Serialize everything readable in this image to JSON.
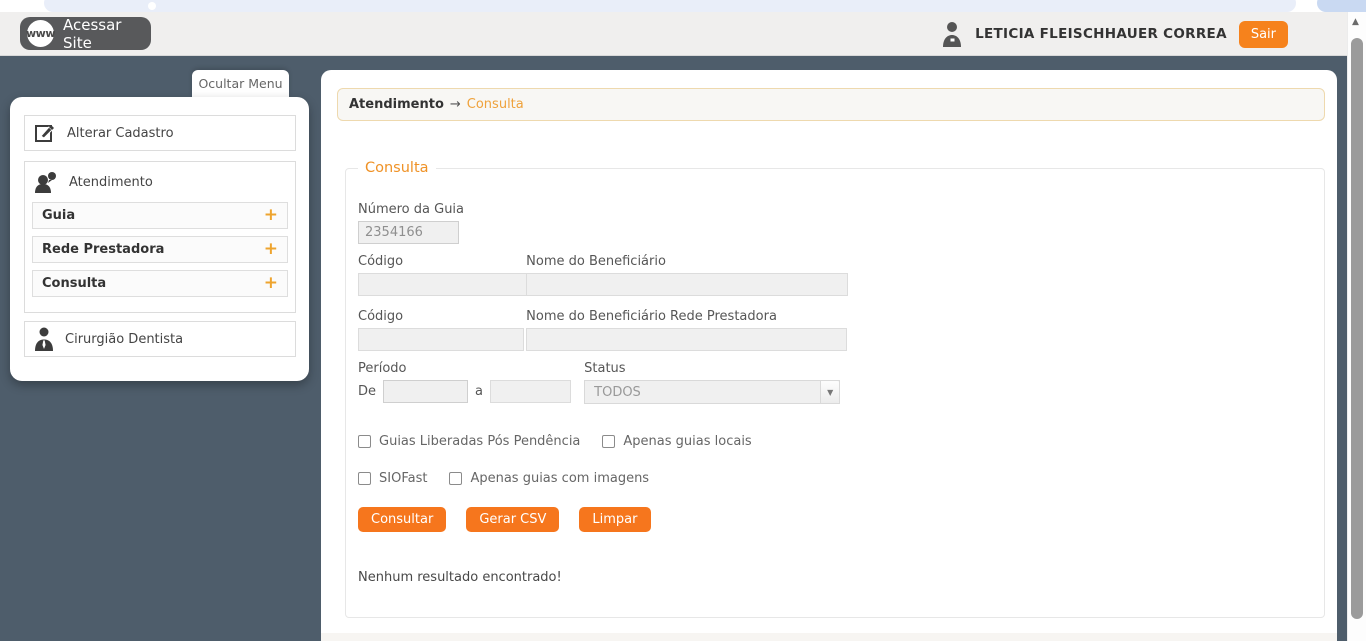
{
  "header": {
    "www_icon_text": "www",
    "access_site_label": "Acessar Site",
    "user_name": "LETICIA FLEISCHHAUER CORREA",
    "logout_label": "Sair"
  },
  "sidebar": {
    "hide_menu_label": "Ocultar Menu",
    "items": [
      {
        "label": "Alterar Cadastro",
        "icon": "edit-icon"
      },
      {
        "label": "Atendimento",
        "icon": "people-icon"
      }
    ],
    "accordion": [
      {
        "label": "Guia",
        "expander": "+"
      },
      {
        "label": "Rede Prestadora",
        "expander": "+"
      },
      {
        "label": "Consulta",
        "expander": "+"
      }
    ],
    "footer_item": {
      "label": "Cirurgião Dentista",
      "icon": "dentist-icon"
    }
  },
  "breadcrumb": {
    "section": "Atendimento",
    "arrow": "→",
    "current": "Consulta"
  },
  "form": {
    "legend": "Consulta",
    "numero_guia": {
      "label": "Número da Guia",
      "value": "2354166"
    },
    "codigo1": {
      "label": "Código",
      "value": ""
    },
    "nome_beneficiario": {
      "label": "Nome do Beneficiário",
      "value": ""
    },
    "codigo2": {
      "label": "Código",
      "value": ""
    },
    "nome_rede": {
      "label": "Nome do Beneficiário Rede Prestadora",
      "value": ""
    },
    "periodo": {
      "label": "Período",
      "de": "De",
      "de_value": "",
      "a": "a",
      "a_value": ""
    },
    "status": {
      "label": "Status",
      "value": "TODOS"
    },
    "checkboxes": [
      {
        "label": "Guias Liberadas Pós Pendência",
        "checked": false
      },
      {
        "label": "Apenas guias locais",
        "checked": false
      },
      {
        "label": "SIOFast",
        "checked": false
      },
      {
        "label": "Apenas guias com imagens",
        "checked": false
      }
    ],
    "buttons": [
      {
        "label": "Consultar"
      },
      {
        "label": "Gerar CSV"
      },
      {
        "label": "Limpar"
      }
    ],
    "result_message": "Nenhum resultado encontrado!"
  },
  "colors": {
    "accent_orange": "#f6761d",
    "logout_orange": "#f6821c",
    "link_orange": "#efa23b",
    "plus_orange": "#eea42f",
    "slate_background": "#4e5d6b",
    "header_gray": "#f0efee",
    "dark_button_gray": "#58595b"
  }
}
